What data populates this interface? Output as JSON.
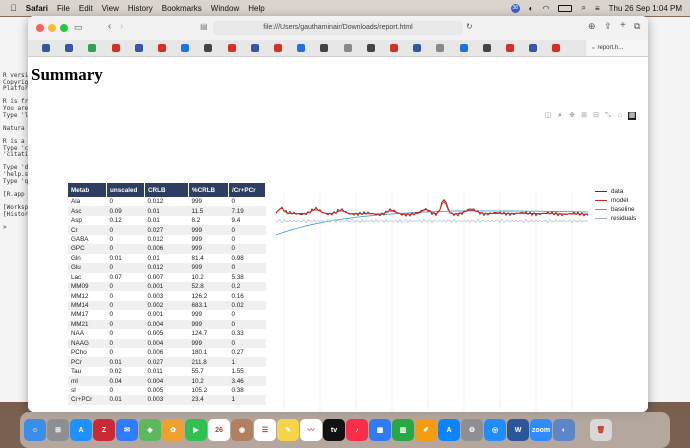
{
  "menubar": {
    "app": "Safari",
    "items": [
      "File",
      "Edit",
      "View",
      "History",
      "Bookmarks",
      "Window",
      "Help"
    ],
    "clock": "Thu 26 Sep  1:04 PM"
  },
  "terminal_lines": [
    "R versio",
    "Copyrigh",
    "Platform",
    "",
    "R is fre",
    "You are ",
    "Type 'li",
    "",
    "  Natura",
    "",
    "R is a c",
    "Type 'co",
    "'citatio",
    "",
    "Type 'de",
    "'help.st",
    "Type 'q'",
    "",
    "[R.app G",
    "",
    "[Workspa",
    "[History",
    "",
    ">"
  ],
  "browser": {
    "address": "file:///Users/gauthaminair/Downloads/report.html",
    "active_tab": "report.h...",
    "tabs": [
      "S",
      "S",
      "G",
      "M",
      "S",
      "M",
      "S",
      "G",
      "M",
      "S",
      "M",
      "S",
      "J",
      "N",
      "G",
      "M",
      "S",
      "N",
      "S",
      "G",
      "M",
      "S",
      "M"
    ]
  },
  "page": {
    "title": "Summary",
    "table": {
      "headers": [
        "Metab",
        "unscaled",
        "CRLB",
        "%CRLB",
        "/Cr+PCr"
      ],
      "rows": [
        [
          "Ala",
          "0",
          "0.012",
          "999",
          "0"
        ],
        [
          "Asc",
          "0.09",
          "0.01",
          "11.5",
          "7.19"
        ],
        [
          "Asp",
          "0.12",
          "0.01",
          "8.2",
          "9.4"
        ],
        [
          "Cr",
          "0",
          "0.027",
          "999",
          "0"
        ],
        [
          "GABA",
          "0",
          "0.012",
          "999",
          "0"
        ],
        [
          "GPC",
          "0",
          "0.006",
          "999",
          "0"
        ],
        [
          "Gln",
          "0.01",
          "0.01",
          "81.4",
          "0.98"
        ],
        [
          "Glu",
          "0",
          "0.012",
          "999",
          "0"
        ],
        [
          "Lac",
          "0.07",
          "0.007",
          "10.2",
          "5.38"
        ],
        [
          "MM09",
          "0",
          "0.001",
          "52.8",
          "0.2"
        ],
        [
          "MM12",
          "0",
          "0.003",
          "126.2",
          "0.16"
        ],
        [
          "MM14",
          "0",
          "0.002",
          "683.1",
          "0.02"
        ],
        [
          "MM17",
          "0",
          "0.001",
          "999",
          "0"
        ],
        [
          "MM21",
          "0",
          "0.004",
          "999",
          "0"
        ],
        [
          "NAA",
          "0",
          "0.005",
          "124.7",
          "0.33"
        ],
        [
          "NAAG",
          "0",
          "0.004",
          "999",
          "0"
        ],
        [
          "PCho",
          "0",
          "0.006",
          "180.1",
          "0.27"
        ],
        [
          "PCr",
          "0.01",
          "0.027",
          "211.8",
          "1"
        ],
        [
          "Tau",
          "0.02",
          "0.011",
          "55.7",
          "1.55"
        ],
        [
          "mI",
          "0.04",
          "0.004",
          "10.2",
          "3.46"
        ],
        [
          "sI",
          "0",
          "0.005",
          "105.2",
          "0.38"
        ],
        [
          "Cr+PCr",
          "0.01",
          "0.003",
          "23.4",
          "1"
        ]
      ]
    },
    "legend": [
      {
        "name": "data",
        "color": "#8b1a1a"
      },
      {
        "name": "model",
        "color": "#cc2222"
      },
      {
        "name": "baseline",
        "color": "#4aa3d8"
      },
      {
        "name": "residuals",
        "color": "#9fb3c8"
      }
    ]
  },
  "dock": {
    "apps": [
      {
        "name": "finder",
        "color": "#3b8ee8",
        "glyph": "☺"
      },
      {
        "name": "launchpad",
        "color": "#8e8e93",
        "glyph": "⊞"
      },
      {
        "name": "app-store",
        "color": "#1e90ff",
        "glyph": "A"
      },
      {
        "name": "zotero",
        "color": "#cc2936",
        "glyph": "Z"
      },
      {
        "name": "mail",
        "color": "#2e7cf6",
        "glyph": "✉"
      },
      {
        "name": "maps",
        "color": "#5cb85c",
        "glyph": "◈"
      },
      {
        "name": "photos",
        "color": "#f0a030",
        "glyph": "✿"
      },
      {
        "name": "facetime",
        "color": "#30c050",
        "glyph": "▶"
      },
      {
        "name": "calendar",
        "color": "#ffffff",
        "glyph": "26"
      },
      {
        "name": "contacts",
        "color": "#b08060",
        "glyph": "◉"
      },
      {
        "name": "reminders",
        "color": "#ffffff",
        "glyph": "☰"
      },
      {
        "name": "notes",
        "color": "#f5d547",
        "glyph": "✎"
      },
      {
        "name": "freeform",
        "color": "#ffffff",
        "glyph": "〰"
      },
      {
        "name": "tv",
        "color": "#111111",
        "glyph": "tv"
      },
      {
        "name": "music",
        "color": "#fa2d48",
        "glyph": "♪"
      },
      {
        "name": "keynote",
        "color": "#2f7bf5",
        "glyph": "▦"
      },
      {
        "name": "numbers",
        "color": "#27a844",
        "glyph": "▥"
      },
      {
        "name": "pages",
        "color": "#f39c12",
        "glyph": "✐"
      },
      {
        "name": "app-store-2",
        "color": "#0d84ff",
        "glyph": "A"
      },
      {
        "name": "system-settings",
        "color": "#8e8e93",
        "glyph": "⚙"
      },
      {
        "name": "safari",
        "color": "#1f8cff",
        "glyph": "◎"
      },
      {
        "name": "word",
        "color": "#2b579a",
        "glyph": "W"
      },
      {
        "name": "zoom",
        "color": "#2d8cff",
        "glyph": "zoom"
      },
      {
        "name": "preview",
        "color": "#5d86c9",
        "glyph": "◐"
      },
      {
        "name": "trash",
        "color": "#d8d8d8",
        "glyph": "🗑"
      }
    ]
  }
}
